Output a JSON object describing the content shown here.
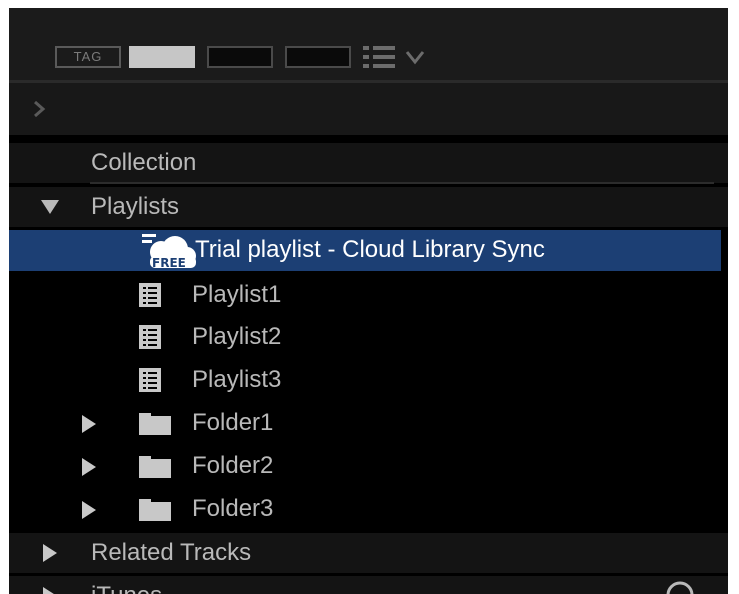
{
  "toolbar": {
    "tag_label": "TAG"
  },
  "tree": {
    "collection_label": "Collection",
    "playlists_label": "Playlists",
    "trial_badge": "FREE",
    "trial_playlist_label": "Trial playlist - Cloud Library Sync",
    "playlist1_label": "Playlist1",
    "playlist2_label": "Playlist2",
    "playlist3_label": "Playlist3",
    "folder1_label": "Folder1",
    "folder2_label": "Folder2",
    "folder3_label": "Folder3",
    "related_tracks_label": "Related Tracks",
    "itunes_label": "iTunes"
  },
  "colors": {
    "selection": "#1c3f74",
    "panel_bg": "#000000",
    "toolbar_bg": "#1b1b1b",
    "text": "#b9b9b9"
  }
}
